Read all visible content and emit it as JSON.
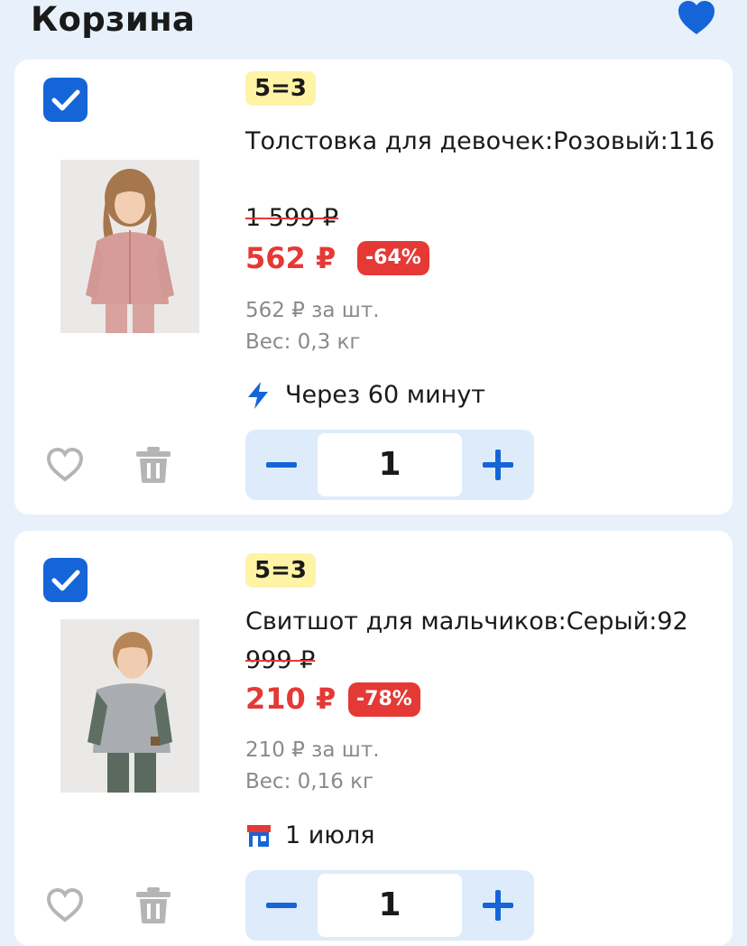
{
  "header": {
    "title": "Корзина",
    "heart_icon": "heart-filled-icon",
    "accent": "#1565d8"
  },
  "items": [
    {
      "checked": true,
      "promo": "5=3",
      "name": "Толстовка для девочек:Розовый:116",
      "old_price": "1 599 ₽",
      "price": "562 ₽",
      "discount": "-64%",
      "unit_price": "562 ₽ за шт.",
      "weight": "Вес: 0,3 кг",
      "delivery_icon": "lightning-icon",
      "delivery": "Через 60 минут",
      "quantity": "1",
      "image_alt": "girl in pink fleece hoodie"
    },
    {
      "checked": true,
      "promo": "5=3",
      "name": "Свитшот для мальчиков:Серый:92",
      "old_price": "999 ₽",
      "price": "210 ₽",
      "discount": "-78%",
      "unit_price": "210 ₽ за шт.",
      "weight": "Вес: 0,16 кг",
      "delivery_icon": "store-icon",
      "delivery": "1 июля",
      "quantity": "1",
      "image_alt": "boy in grey sweatshirt"
    }
  ],
  "colors": {
    "price": "#e53935",
    "promo_bg": "#fff3a6",
    "stepper_bg": "#deebfb",
    "background": "#e8f1fb"
  }
}
